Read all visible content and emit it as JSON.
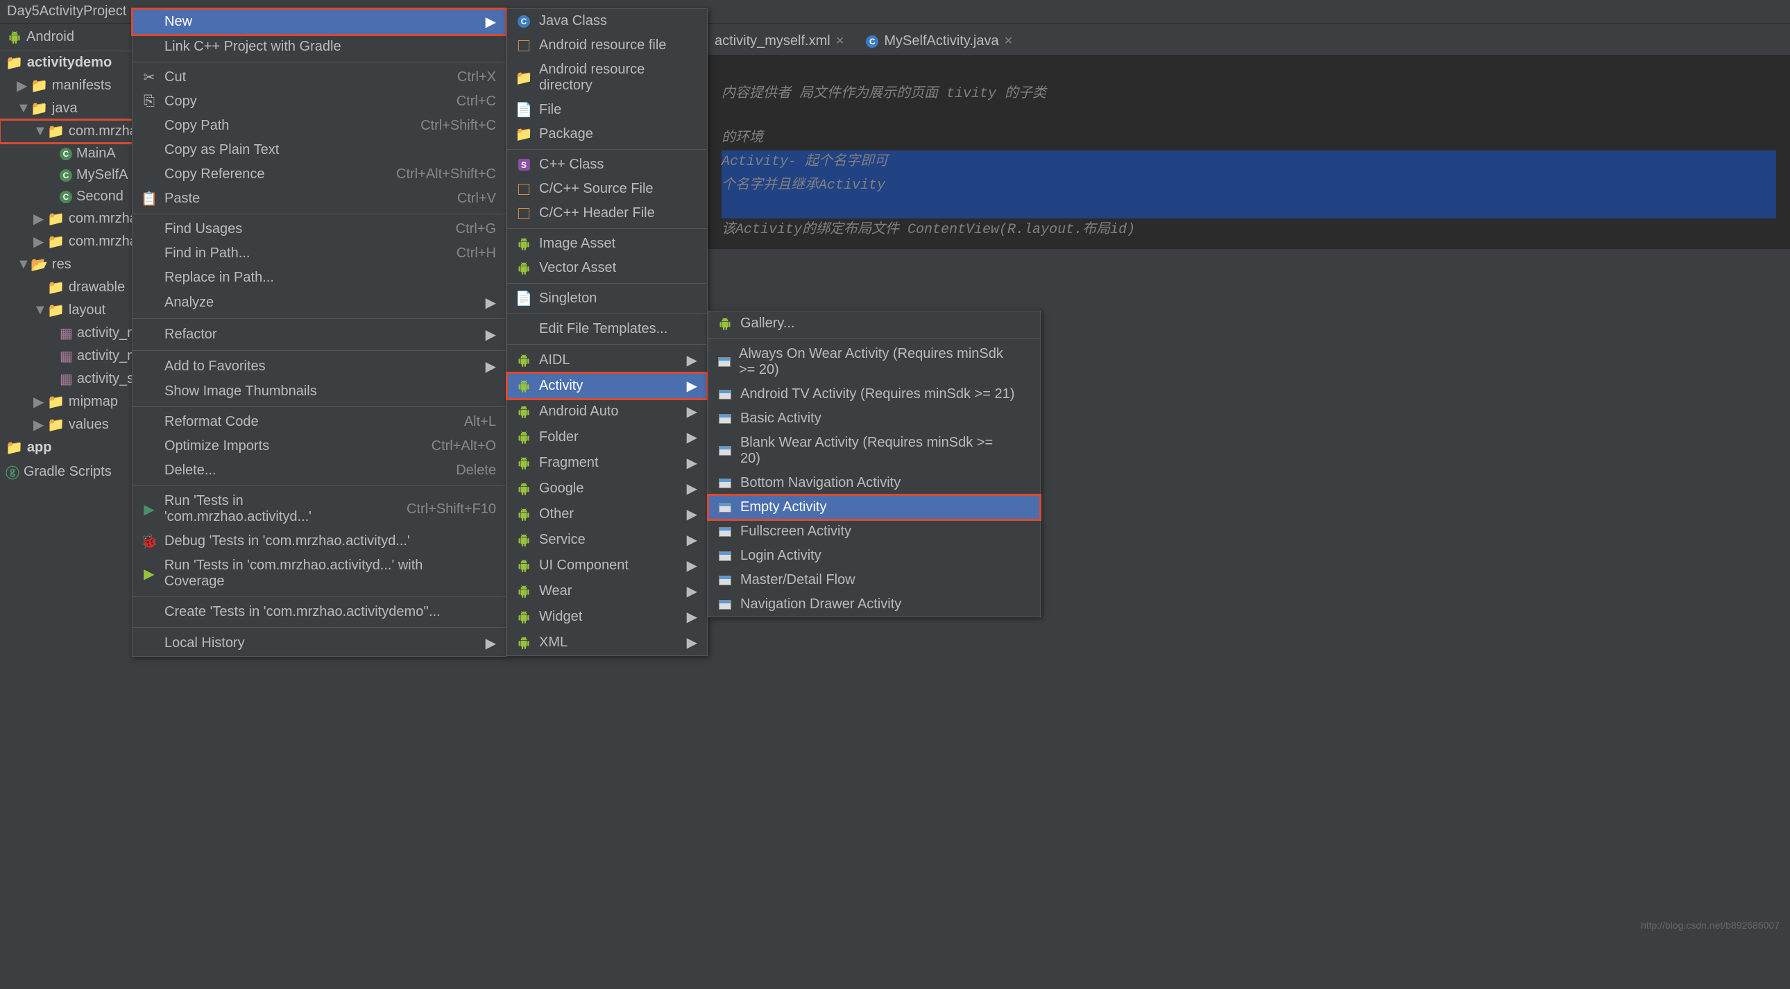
{
  "breadcrumb": "Day5ActivityProject",
  "sidebar": {
    "selector": "Android"
  },
  "tree": {
    "app_root": "activitydemo",
    "manifests": "manifests",
    "java": "java",
    "pkg_main": "com.mrzhao",
    "main_activity": "MainA",
    "myself_activity": "MySelfA",
    "second_activity": "Second",
    "pkg_test1": "com.mrzhao",
    "pkg_test2": "com.mrzhao",
    "res": "res",
    "drawable": "drawable",
    "layout": "layout",
    "xml_main": "activity_m",
    "xml_myself": "activity_m",
    "xml_second": "activity_se",
    "mipmap": "mipmap",
    "values": "values",
    "app": "app",
    "gradle": "Gradle Scripts"
  },
  "tabs": {
    "tab1": "activity_myself.xml",
    "tab2": "MySelfActivity.java"
  },
  "code": {
    "l1": "内容提供者",
    "l2": "局文件作为展示的页面",
    "l3": "tivity 的子类",
    "l4": "的环境",
    "l5": "Activity- 起个名字即可",
    "l6": "个名字并且继承Activity",
    "l7": "该Activity的绑定布局文件",
    "l8": "ContentView(R.layout.布局id)"
  },
  "context_menu": [
    {
      "label": "New",
      "shortcut": "",
      "arrow": true,
      "selected": true
    },
    {
      "label": "Link C++ Project with Gradle",
      "shortcut": ""
    },
    {
      "sep": true
    },
    {
      "label": "Cut",
      "shortcut": "Ctrl+X",
      "icon": "cut"
    },
    {
      "label": "Copy",
      "shortcut": "Ctrl+C",
      "icon": "copy"
    },
    {
      "label": "Copy Path",
      "shortcut": "Ctrl+Shift+C"
    },
    {
      "label": "Copy as Plain Text",
      "shortcut": ""
    },
    {
      "label": "Copy Reference",
      "shortcut": "Ctrl+Alt+Shift+C"
    },
    {
      "label": "Paste",
      "shortcut": "Ctrl+V",
      "icon": "paste"
    },
    {
      "sep": true
    },
    {
      "label": "Find Usages",
      "shortcut": "Ctrl+G"
    },
    {
      "label": "Find in Path...",
      "shortcut": "Ctrl+H"
    },
    {
      "label": "Replace in Path...",
      "shortcut": ""
    },
    {
      "label": "Analyze",
      "shortcut": "",
      "arrow": true
    },
    {
      "sep": true
    },
    {
      "label": "Refactor",
      "shortcut": "",
      "arrow": true
    },
    {
      "sep": true
    },
    {
      "label": "Add to Favorites",
      "shortcut": "",
      "arrow": true
    },
    {
      "label": "Show Image Thumbnails",
      "shortcut": ""
    },
    {
      "sep": true
    },
    {
      "label": "Reformat Code",
      "shortcut": "Alt+L"
    },
    {
      "label": "Optimize Imports",
      "shortcut": "Ctrl+Alt+O"
    },
    {
      "label": "Delete...",
      "shortcut": "Delete"
    },
    {
      "sep": true
    },
    {
      "label": "Run 'Tests in 'com.mrzhao.activityd...'",
      "shortcut": "Ctrl+Shift+F10",
      "icon": "run"
    },
    {
      "label": "Debug 'Tests in 'com.mrzhao.activityd...'",
      "shortcut": "",
      "icon": "debug"
    },
    {
      "label": "Run 'Tests in 'com.mrzhao.activityd...' with Coverage",
      "shortcut": "",
      "icon": "coverage"
    },
    {
      "sep": true
    },
    {
      "label": "Create 'Tests in 'com.mrzhao.activitydemo''...",
      "shortcut": ""
    },
    {
      "sep": true
    },
    {
      "label": "Local History",
      "shortcut": "",
      "arrow": true
    }
  ],
  "new_submenu": [
    {
      "label": "Java Class",
      "icon": "class-c"
    },
    {
      "label": "Android resource file",
      "icon": "orange-file"
    },
    {
      "label": "Android resource directory",
      "icon": "folder"
    },
    {
      "label": "File",
      "icon": "file"
    },
    {
      "label": "Package",
      "icon": "package"
    },
    {
      "sep": true
    },
    {
      "label": "C++ Class",
      "icon": "purple-s"
    },
    {
      "label": "C/C++ Source File",
      "icon": "cpp-file"
    },
    {
      "label": "C/C++ Header File",
      "icon": "cpp-file"
    },
    {
      "sep": true
    },
    {
      "label": "Image Asset",
      "icon": "android"
    },
    {
      "label": "Vector Asset",
      "icon": "android"
    },
    {
      "sep": true
    },
    {
      "label": "Singleton",
      "icon": "file"
    },
    {
      "sep": true
    },
    {
      "label": "Edit File Templates...",
      "icon": ""
    },
    {
      "sep": true
    },
    {
      "label": "AIDL",
      "icon": "android",
      "arrow": true
    },
    {
      "label": "Activity",
      "icon": "android",
      "arrow": true,
      "selected": true
    },
    {
      "label": "Android Auto",
      "icon": "android",
      "arrow": true
    },
    {
      "label": "Folder",
      "icon": "android",
      "arrow": true
    },
    {
      "label": "Fragment",
      "icon": "android",
      "arrow": true
    },
    {
      "label": "Google",
      "icon": "android",
      "arrow": true
    },
    {
      "label": "Other",
      "icon": "android",
      "arrow": true
    },
    {
      "label": "Service",
      "icon": "android",
      "arrow": true
    },
    {
      "label": "UI Component",
      "icon": "android",
      "arrow": true
    },
    {
      "label": "Wear",
      "icon": "android",
      "arrow": true
    },
    {
      "label": "Widget",
      "icon": "android",
      "arrow": true
    },
    {
      "label": "XML",
      "icon": "android",
      "arrow": true
    }
  ],
  "activity_submenu": [
    {
      "label": "Gallery...",
      "icon": "android"
    },
    {
      "sep": true
    },
    {
      "label": "Always On Wear Activity (Requires minSdk >= 20)",
      "icon": "activity"
    },
    {
      "label": "Android TV Activity (Requires minSdk >= 21)",
      "icon": "activity"
    },
    {
      "label": "Basic Activity",
      "icon": "activity"
    },
    {
      "label": "Blank Wear Activity (Requires minSdk >= 20)",
      "icon": "activity"
    },
    {
      "label": "Bottom Navigation Activity",
      "icon": "activity"
    },
    {
      "label": "Empty Activity",
      "icon": "activity",
      "selected": true
    },
    {
      "label": "Fullscreen Activity",
      "icon": "activity"
    },
    {
      "label": "Login Activity",
      "icon": "activity"
    },
    {
      "label": "Master/Detail Flow",
      "icon": "activity"
    },
    {
      "label": "Navigation Drawer Activity",
      "icon": "activity"
    }
  ],
  "watermark": "http://blog.csdn.net/b892686007"
}
